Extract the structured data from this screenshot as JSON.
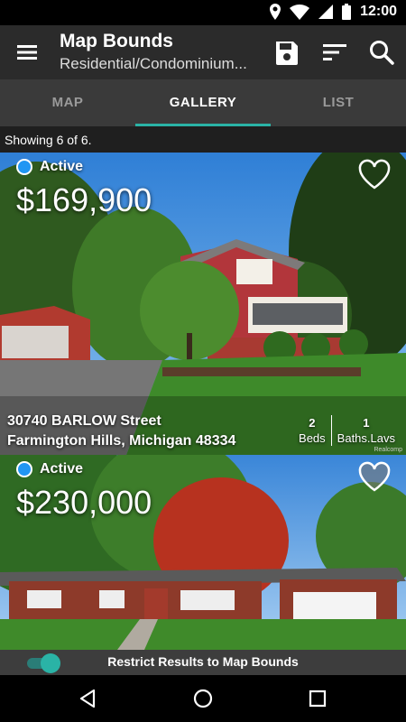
{
  "status_bar": {
    "time": "12:00",
    "icons": [
      "location-icon",
      "wifi-icon",
      "signal-icon",
      "battery-icon"
    ]
  },
  "toolbar": {
    "title": "Map Bounds",
    "subtitle": "Residential/Condominium...",
    "icons": [
      "menu-icon",
      "save-icon",
      "sort-icon",
      "search-icon"
    ]
  },
  "tabs": [
    {
      "label": "MAP",
      "active": false
    },
    {
      "label": "GALLERY",
      "active": true
    },
    {
      "label": "LIST",
      "active": false
    }
  ],
  "results": {
    "count_text": "Showing 6 of 6."
  },
  "listings": [
    {
      "status": "Active",
      "price": "$169,900",
      "street": "30740 BARLOW Street",
      "city_line": "Farmington Hills, Michigan 48334",
      "beds_value": "2",
      "beds_label": "Beds",
      "baths_value": "1",
      "baths_label": "Baths.Lavs",
      "photo_credit": "Realcomp"
    },
    {
      "status": "Active",
      "price": "$230,000"
    }
  ],
  "restrict": {
    "label": "Restrict Results to Map Bounds",
    "enabled": true
  },
  "colors": {
    "accent": "#2ab3a6",
    "status_dot": "#2196f3",
    "toolbar": "#2b2b2b",
    "tabs": "#3a3a3a"
  }
}
